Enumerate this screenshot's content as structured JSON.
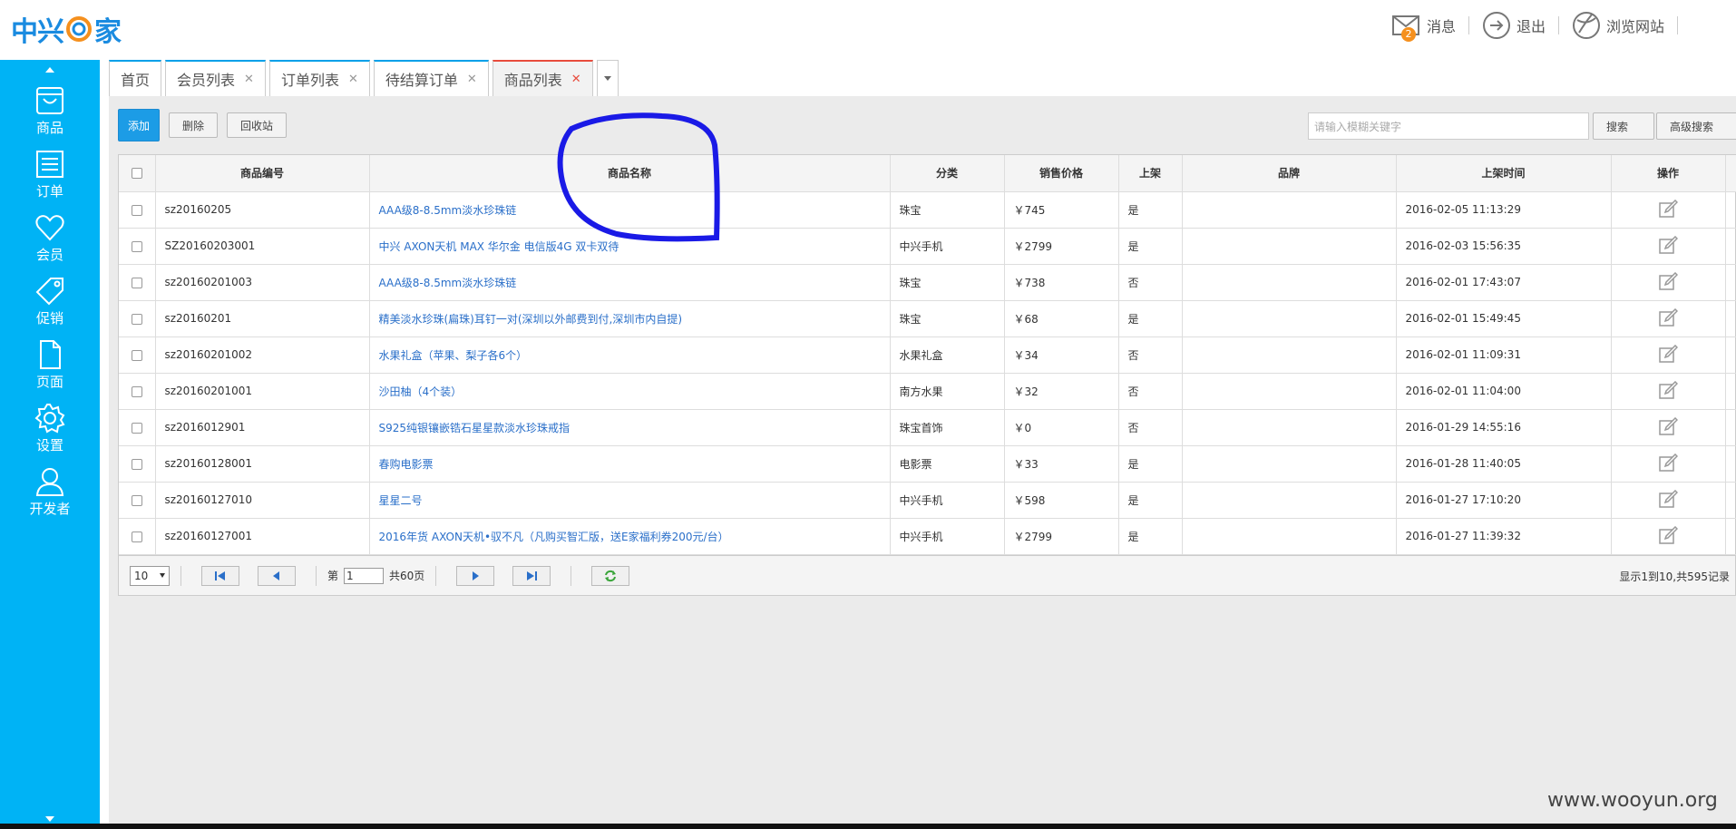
{
  "brand": {
    "logo_left": "中兴",
    "logo_right": "家",
    "accent": "#00b3f5"
  },
  "topnav": {
    "messages": {
      "label": "消息",
      "badge": "2",
      "icon": "mail-icon"
    },
    "logout": {
      "label": "退出",
      "icon": "logout-arrow-icon"
    },
    "browse": {
      "label": "浏览网站",
      "icon": "globe-icon"
    }
  },
  "sidebar": {
    "items": [
      {
        "label": "商品",
        "icon": "bag-icon"
      },
      {
        "label": "订单",
        "icon": "list-icon"
      },
      {
        "label": "会员",
        "icon": "heart-icon"
      },
      {
        "label": "促销",
        "icon": "tag-icon"
      },
      {
        "label": "页面",
        "icon": "page-icon"
      },
      {
        "label": "设置",
        "icon": "gear-icon"
      },
      {
        "label": "开发者",
        "icon": "user-icon"
      }
    ]
  },
  "tabs": [
    {
      "label": "首页",
      "closable": false
    },
    {
      "label": "会员列表",
      "closable": true
    },
    {
      "label": "订单列表",
      "closable": true
    },
    {
      "label": "待结算订单",
      "closable": true
    },
    {
      "label": "商品列表",
      "closable": true,
      "active": true
    }
  ],
  "toolbar": {
    "add": "添加",
    "delete": "删除",
    "recycle": "回收站"
  },
  "search": {
    "placeholder": "请输入模糊关键字",
    "search_label": "搜索",
    "advanced_label": "高级搜索"
  },
  "table": {
    "headers": [
      "商品编号",
      "商品名称",
      "分类",
      "销售价格",
      "上架",
      "品牌",
      "上架时间",
      "操作"
    ],
    "rows": [
      {
        "id": "sz20160205",
        "name": "AAA级8-8.5mm淡水珍珠链",
        "category": "珠宝",
        "price": "￥745",
        "listed": "是",
        "brand": "",
        "time": "2016-02-05 11:13:29"
      },
      {
        "id": "SZ20160203001",
        "name": "中兴 AXON天机 MAX 华尔金 电信版4G 双卡双待",
        "category": "中兴手机",
        "price": "￥2799",
        "listed": "是",
        "brand": "",
        "time": "2016-02-03 15:56:35"
      },
      {
        "id": "sz20160201003",
        "name": "AAA级8-8.5mm淡水珍珠链",
        "category": "珠宝",
        "price": "￥738",
        "listed": "否",
        "brand": "",
        "time": "2016-02-01 17:43:07"
      },
      {
        "id": "sz20160201",
        "name": "精美淡水珍珠(扁珠)耳钉一对(深圳以外邮费到付,深圳市内自提)",
        "category": "珠宝",
        "price": "￥68",
        "listed": "是",
        "brand": "",
        "time": "2016-02-01 15:49:45"
      },
      {
        "id": "sz20160201002",
        "name": "水果礼盒（苹果、梨子各6个）",
        "category": "水果礼盒",
        "price": "￥34",
        "listed": "否",
        "brand": "",
        "time": "2016-02-01 11:09:31"
      },
      {
        "id": "sz20160201001",
        "name": "沙田柚（4个装）",
        "category": "南方水果",
        "price": "￥32",
        "listed": "否",
        "brand": "",
        "time": "2016-02-01 11:04:00"
      },
      {
        "id": "sz2016012901",
        "name": "S925纯银镶嵌锆石星星款淡水珍珠戒指",
        "category": "珠宝首饰",
        "price": "￥0",
        "listed": "否",
        "brand": "",
        "time": "2016-01-29 14:55:16"
      },
      {
        "id": "sz20160128001",
        "name": "春购电影票",
        "category": "电影票",
        "price": "￥33",
        "listed": "是",
        "brand": "",
        "time": "2016-01-28 11:40:05"
      },
      {
        "id": "sz20160127010",
        "name": "星星二号",
        "category": "中兴手机",
        "price": "￥598",
        "listed": "是",
        "brand": "",
        "time": "2016-01-27 17:10:20"
      },
      {
        "id": "sz20160127001",
        "name": "2016年货 AXON天机•驭不凡（凡购买智汇版，送E家福利券200元/台）",
        "category": "中兴手机",
        "price": "￥2799",
        "listed": "是",
        "brand": "",
        "time": "2016-01-27 11:39:32"
      }
    ]
  },
  "pager": {
    "page_size": "10",
    "page_prefix": "第",
    "page_value": "1",
    "total_pages": "共60页",
    "info": "显示1到10,共595记录"
  },
  "watermark": "www.wooyun.org"
}
